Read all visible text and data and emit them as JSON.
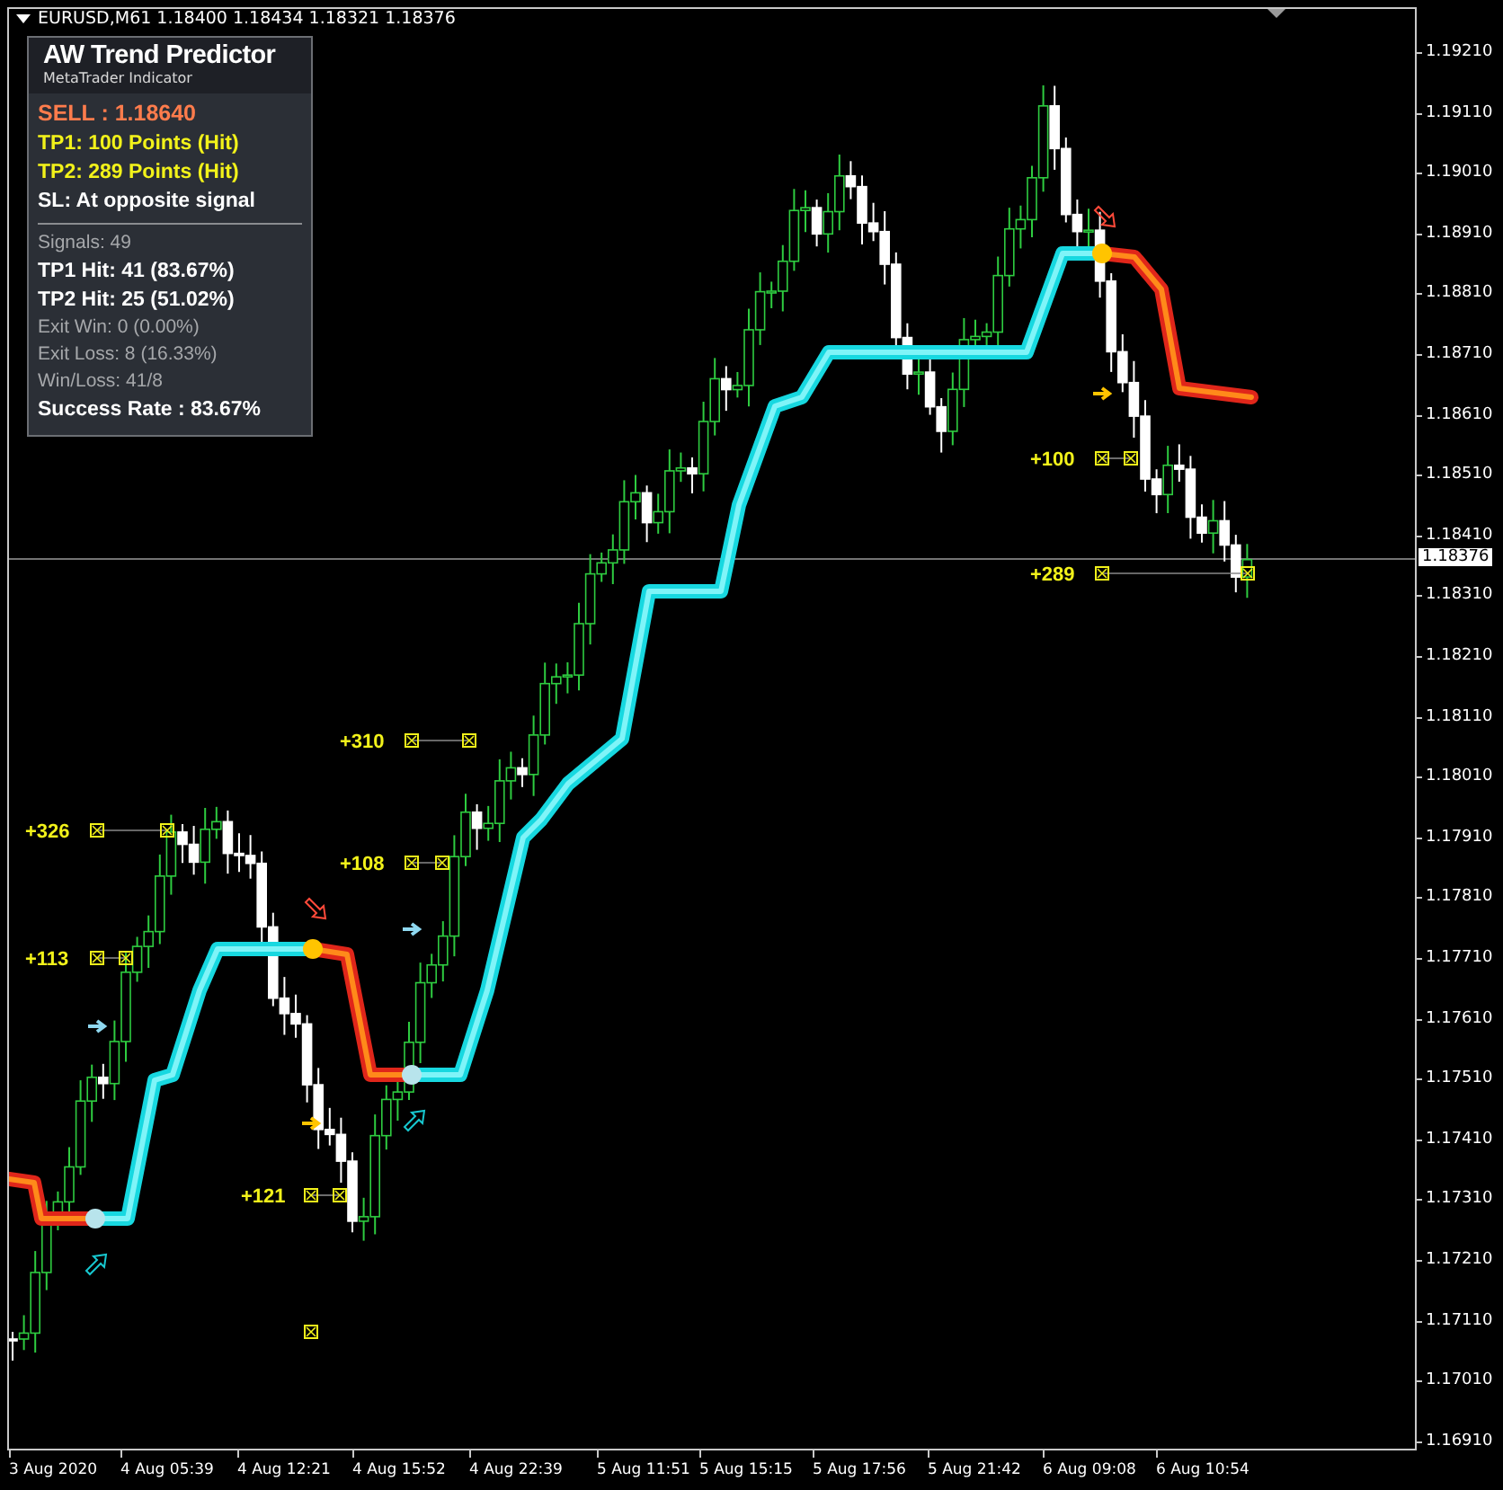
{
  "chart": {
    "header": "EURUSD,M61  1.18400 1.18434 1.18321 1.18376"
  },
  "indicator_panel": {
    "title": "AW Trend Predictor",
    "subtitle": "MetaTrader Indicator",
    "signal": "SELL : 1.18640",
    "targets": [
      {
        "kind": "tp",
        "text": "TP1: 100 Points (Hit)"
      },
      {
        "kind": "tp",
        "text": "TP2: 289 Points (Hit)"
      },
      {
        "kind": "sl",
        "text": "SL:  At opposite signal"
      }
    ],
    "stats": [
      {
        "kind": "dim",
        "text": "Signals: 49"
      },
      {
        "kind": "bold",
        "text": "TP1 Hit: 41 (83.67%)"
      },
      {
        "kind": "bold",
        "text": "TP2 Hit: 25 (51.02%)"
      },
      {
        "kind": "dim",
        "text": "Exit Win: 0 (0.00%)"
      },
      {
        "kind": "dim",
        "text": "Exit Loss: 8 (16.33%)"
      },
      {
        "kind": "dim",
        "text": "Win/Loss: 41/8"
      },
      {
        "kind": "bold",
        "text": "Success Rate : 83.67%"
      }
    ]
  },
  "annotations": [
    "+326",
    "+113",
    "+121",
    "+108",
    "+310",
    "+100",
    "+289"
  ],
  "price_axis": {
    "labels": [
      "1.19210",
      "1.19110",
      "1.19010",
      "1.18910",
      "1.18810",
      "1.18710",
      "1.18610",
      "1.18510",
      "1.18410",
      "1.18310",
      "1.18210",
      "1.18110",
      "1.18010",
      "1.17910",
      "1.17810",
      "1.17710",
      "1.17610",
      "1.17510",
      "1.17410",
      "1.17310",
      "1.17210",
      "1.17110",
      "1.17010",
      "1.16910"
    ],
    "current_price": "1.18376"
  },
  "time_axis": {
    "labels": [
      "3 Aug 2020",
      "4 Aug 05:39",
      "4 Aug 12:21",
      "4 Aug 15:52",
      "4 Aug 22:39",
      "5 Aug 11:51",
      "5 Aug 15:15",
      "5 Aug 17:56",
      "5 Aug 21:42",
      "6 Aug 09:08",
      "6 Aug 10:54"
    ]
  }
}
